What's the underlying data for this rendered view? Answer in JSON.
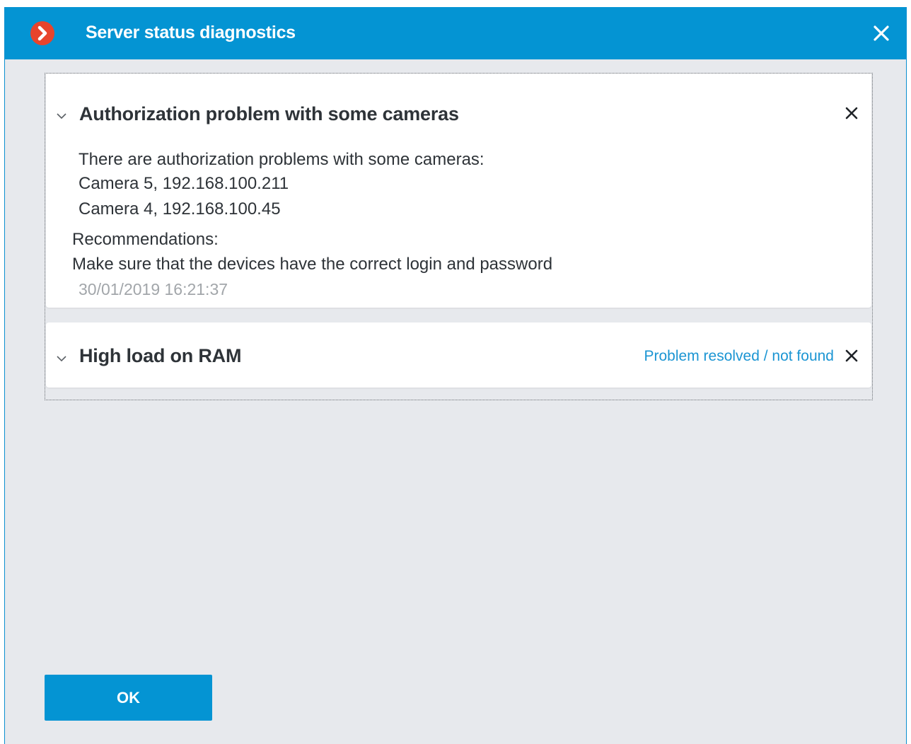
{
  "window": {
    "title": "Server status diagnostics",
    "logo_icon": "app-logo-chevron-icon",
    "close_icon": "close-icon",
    "accent_color": "#0494d3",
    "logo_color": "#e8442c"
  },
  "issues": [
    {
      "title": "Authorization problem with some cameras",
      "expanded": true,
      "description": "There are authorization problems with some cameras:",
      "cameras": [
        "Camera 5, 192.168.100.211",
        "Camera 4, 192.168.100.45"
      ],
      "recommendations_label": "Recommendations:",
      "recommendation": "Make sure that the devices have the correct login and password",
      "timestamp": "30/01/2019 16:21:37",
      "chevron_icon": "chevron-down-icon",
      "dismiss_icon": "close-icon"
    },
    {
      "title": "High load on RAM",
      "expanded": false,
      "status": "Problem resolved / not found",
      "status_color": "#1b95d3",
      "chevron_icon": "chevron-down-icon",
      "dismiss_icon": "close-icon"
    }
  ],
  "footer": {
    "ok_label": "OK"
  }
}
